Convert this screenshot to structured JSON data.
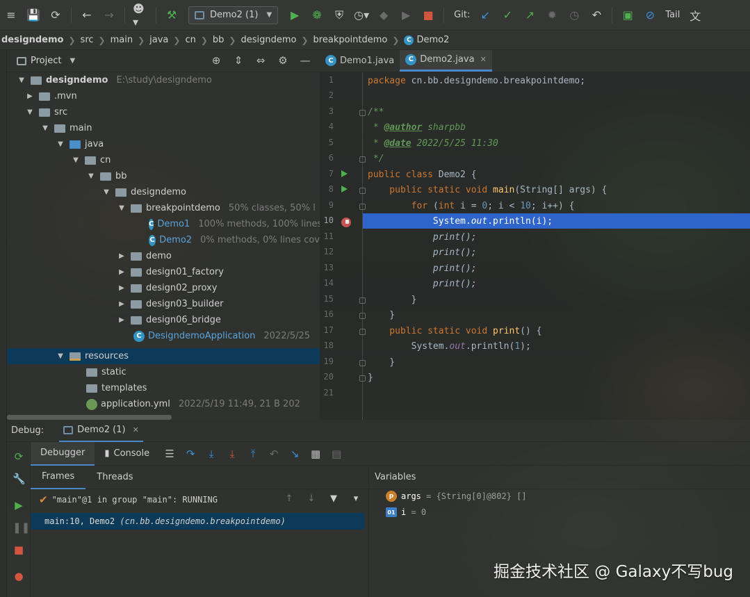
{
  "toolbar": {
    "run_config": "Demo2 (1)",
    "git_label": "Git:",
    "tail_label": "Tail"
  },
  "breadcrumbs": [
    "designdemo",
    "src",
    "main",
    "java",
    "cn",
    "bb",
    "designdemo",
    "breakpointdemo",
    "Demo2"
  ],
  "project": {
    "title": "Project",
    "tree": [
      {
        "label": "designdemo",
        "meta": "E:\\study\\designdemo"
      },
      {
        "label": ".mvn",
        "meta": ""
      },
      {
        "label": "src",
        "meta": ""
      },
      {
        "label": "main",
        "meta": ""
      },
      {
        "label": "java",
        "meta": ""
      },
      {
        "label": "cn",
        "meta": ""
      },
      {
        "label": "bb",
        "meta": ""
      },
      {
        "label": "designdemo",
        "meta": ""
      },
      {
        "label": "breakpointdemo",
        "meta": "50% classes, 50% l"
      },
      {
        "label": "Demo1",
        "meta": "100% methods, 100% lines"
      },
      {
        "label": "Demo2",
        "meta": "0% methods, 0% lines cov"
      },
      {
        "label": "demo",
        "meta": ""
      },
      {
        "label": "design01_factory",
        "meta": ""
      },
      {
        "label": "design02_proxy",
        "meta": ""
      },
      {
        "label": "design03_builder",
        "meta": ""
      },
      {
        "label": "design06_bridge",
        "meta": ""
      },
      {
        "label": "DesigndemoApplication",
        "meta": "2022/5/25"
      },
      {
        "label": "resources",
        "meta": ""
      },
      {
        "label": "static",
        "meta": ""
      },
      {
        "label": "templates",
        "meta": ""
      },
      {
        "label": "application.yml",
        "meta": "2022/5/19 11:49, 21 B 202"
      }
    ]
  },
  "editor": {
    "tabs": [
      {
        "label": "Demo1.java"
      },
      {
        "label": "Demo2.java"
      }
    ],
    "line_numbers": [
      "1",
      "2",
      "3",
      "4",
      "5",
      "6",
      "7",
      "8",
      "9",
      "10",
      "11",
      "12",
      "13",
      "14",
      "15",
      "16",
      "17",
      "18",
      "19",
      "20",
      "21"
    ],
    "code": {
      "l1_kw": "package ",
      "l1_rest": "cn.bb.designdemo.breakpointdemo;",
      "l3": "/**",
      "l4_star": " * ",
      "l4_tag": "@author",
      "l4_rest": " sharpbb",
      "l5_star": " * ",
      "l5_tag": "@date",
      "l5_rest": " 2022/5/25 11:30",
      "l6": " */",
      "l7_kw": "public class ",
      "l7_rest": "Demo2 {",
      "l8_kw": "    public static void ",
      "l8_fn": "main",
      "l8_rest": "(String[] args) {",
      "l9_indent": "        ",
      "l9_kw": "for ",
      "l9_a": "(",
      "l9_kw2": "int ",
      "l9_b": "i = ",
      "l9_n0": "0",
      "l9_c": "; i < ",
      "l9_n10": "10",
      "l9_d": "; i++) {",
      "l10_a": "            System.",
      "l10_out": "out",
      "l10_b": ".println(i);",
      "l11": "            print();",
      "l12": "            print();",
      "l13": "            print();",
      "l14": "            print();",
      "l15": "        }",
      "l16": "    }",
      "l17_kw": "    public static void ",
      "l17_fn": "print",
      "l17_rest": "() {",
      "l18_a": "        System.",
      "l18_out": "out",
      "l18_b": ".println(",
      "l18_n": "1",
      "l18_c": ");",
      "l19": "    }",
      "l20": "}"
    }
  },
  "debug": {
    "label": "Debug:",
    "session": "Demo2 (1)",
    "tabs": {
      "debugger": "Debugger",
      "console": "Console"
    },
    "frames_tab": "Frames",
    "threads_tab": "Threads",
    "thread": "\"main\"@1 in group \"main\": RUNNING",
    "frame_main": "main:10, Demo2 ",
    "frame_pkg": "(cn.bb.designdemo.breakpointdemo)",
    "variables_title": "Variables",
    "variables": [
      {
        "icon": "p",
        "name": "args",
        "value": " = {String[0]@802} []"
      },
      {
        "icon": "01",
        "name": "i",
        "value": " = 0"
      }
    ]
  },
  "watermark": "掘金技术社区 @ Galaxy不写bug"
}
